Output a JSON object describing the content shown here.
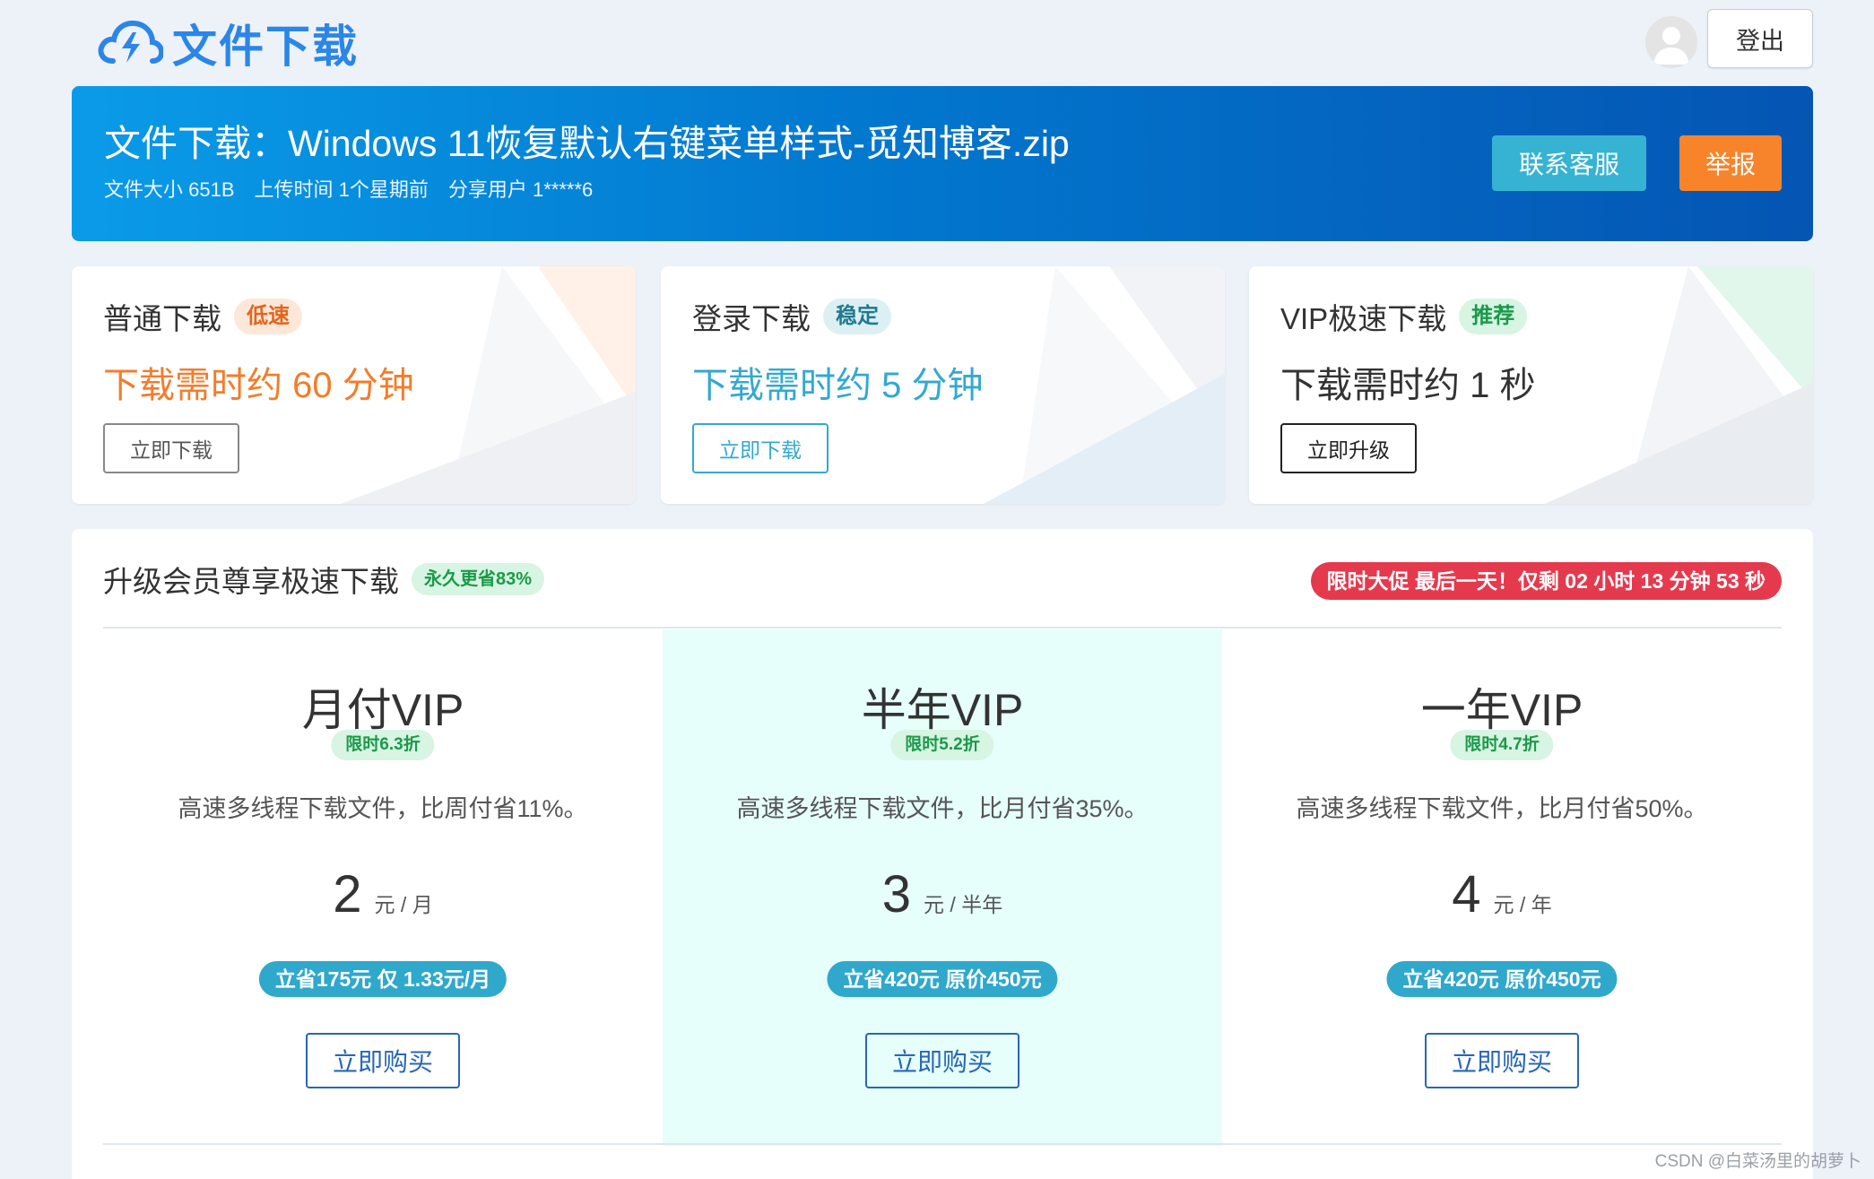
{
  "colors": {
    "brand": "#2b86e8",
    "accent_orange": "#f7842b",
    "accent_cyan": "#36b3d2",
    "promo_red": "#e53a4e",
    "tag_green": "#1b9a4a"
  },
  "header": {
    "logo_text": "文件下载",
    "logo_icon": "cloud-lightning-icon",
    "avatar_icon": "user-avatar-icon",
    "logout_label": "登出"
  },
  "banner": {
    "title": "文件下载：Windows 11恢复默认右键菜单样式-觅知博客.zip",
    "size": "文件大小 651B",
    "upload_time": "上传时间 1个星期前",
    "share_user": "分享用户 1*****6",
    "contact_label": "联系客服",
    "report_label": "举报"
  },
  "download_options": [
    {
      "title": "普通下载",
      "tag": "低速",
      "time": "下载需时约 60 分钟",
      "button": "立即下载"
    },
    {
      "title": "登录下载",
      "tag": "稳定",
      "time": "下载需时约 5 分钟",
      "button": "立即下载"
    },
    {
      "title": "VIP极速下载",
      "tag": "推荐",
      "time": "下载需时约 1 秒",
      "button": "立即升级"
    }
  ],
  "membership": {
    "title": "升级会员尊享极速下载",
    "tag": "永久更省83%",
    "promo": "限时大促 最后一天！仅剩 02 小时 13 分钟 53 秒",
    "plans": [
      {
        "name": "月付VIP",
        "discount": "限时6.3折",
        "desc": "高速多线程下载文件，比周付省11%。",
        "price": "2",
        "unit": "元 / 月",
        "save": "立省175元 仅 1.33元/月",
        "button": "立即购买"
      },
      {
        "name": "半年VIP",
        "discount": "限时5.2折",
        "desc": "高速多线程下载文件，比月付省35%。",
        "price": "3",
        "unit": "元 / 半年",
        "save": "立省420元 原价450元",
        "button": "立即购买"
      },
      {
        "name": "一年VIP",
        "discount": "限时4.7折",
        "desc": "高速多线程下载文件，比月付省50%。",
        "price": "4",
        "unit": "元 / 年",
        "save": "立省420元 原价450元",
        "button": "立即购买"
      }
    ]
  },
  "watermark": "CSDN @白菜汤里的胡萝卜"
}
